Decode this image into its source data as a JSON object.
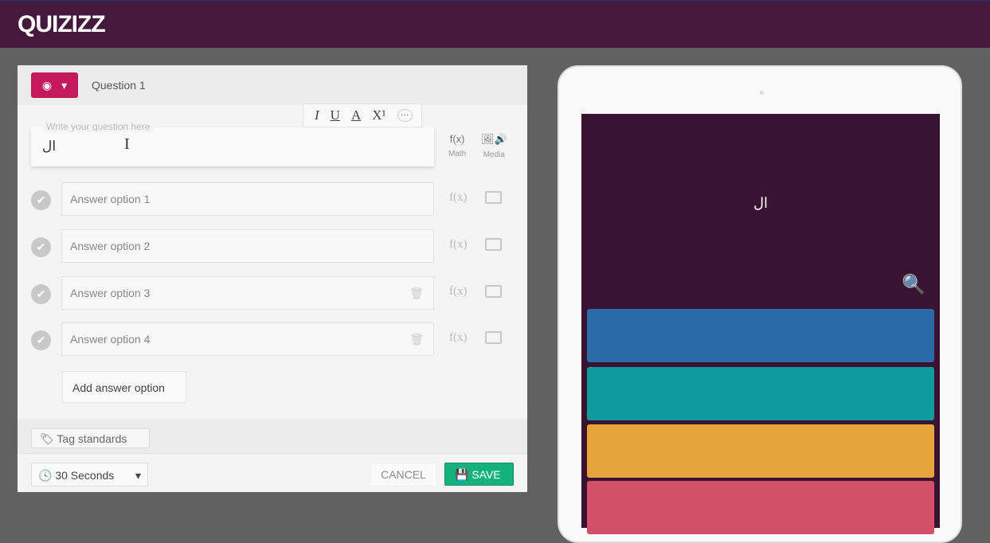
{
  "header": {
    "logo": "QUIZIZZ"
  },
  "editor": {
    "question_label": "Question 1",
    "toolbar": {
      "italic": "I",
      "underline": "U",
      "color": "A",
      "superscript": "X¹",
      "more": "···"
    },
    "question_placeholder": "Write your question here",
    "question_value": "ال",
    "math_label": "Math",
    "media_label": "Media",
    "math_icon": "f(x)",
    "answers": [
      {
        "placeholder": "Answer option 1",
        "deletable": false
      },
      {
        "placeholder": "Answer option 2",
        "deletable": false
      },
      {
        "placeholder": "Answer option 3",
        "deletable": true
      },
      {
        "placeholder": "Answer option 4",
        "deletable": true
      }
    ],
    "add_answer_label": "Add answer option",
    "tag_label": "Tag standards",
    "time_value": "30 Seconds",
    "cancel_label": "CANCEL",
    "save_label": "SAVE"
  },
  "preview": {
    "question_text": "ال",
    "option_colors": [
      "#2a6aa8",
      "#0e9a9f",
      "#e6a53b",
      "#d44f6a"
    ]
  },
  "colors": {
    "header": "#45193c",
    "accent": "#c3195d",
    "save": "#13b17b"
  }
}
